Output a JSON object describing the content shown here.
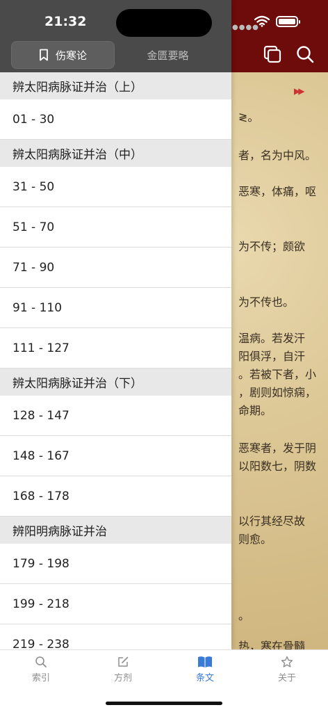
{
  "status": {
    "time": "21:32"
  },
  "drawer": {
    "tabs": [
      {
        "label": "伤寒论",
        "selected": true
      },
      {
        "label": "金匮要略",
        "selected": false
      }
    ],
    "sections": [
      {
        "title": "辨太阳病脉证并治（上）",
        "rows": [
          "01 - 30"
        ]
      },
      {
        "title": "辨太阳病脉证并治（中）",
        "rows": [
          "31 - 50",
          "51 - 70",
          "71 - 90",
          "91 - 110",
          "111 - 127"
        ]
      },
      {
        "title": "辨太阳病脉证并治（下）",
        "rows": [
          "128 - 147",
          "148 - 167",
          "168 - 178"
        ]
      },
      {
        "title": "辨阳明病脉证并治",
        "rows": [
          "179 - 198",
          "199 - 218",
          "219 - 238"
        ]
      }
    ]
  },
  "background_text": [
    "≷。",
    "者，名为中风。",
    "恶寒，体痛，呕",
    "为不传；颇欲",
    "为不传也。",
    "温病。若发汗",
    "阳俱浮，自汗",
    "。若被下者，小",
    "，剧则如惊痫，",
    "命期。",
    "恶寒者，发于阴",
    "以阳数七，阴数",
    "以行其经尽故",
    "则愈。",
    "。",
    "热，寒在骨髓"
  ],
  "tabbar": {
    "items": [
      {
        "label": "索引",
        "icon": "search-icon",
        "active": false
      },
      {
        "label": "方剂",
        "icon": "edit-icon",
        "active": false
      },
      {
        "label": "条文",
        "icon": "book-icon",
        "active": true
      },
      {
        "label": "关于",
        "icon": "star-icon",
        "active": false
      }
    ]
  },
  "colors": {
    "header_bg": "#6e0b0b",
    "drawer_header": "#4a4a4a",
    "accent": "#3a7bd5"
  }
}
